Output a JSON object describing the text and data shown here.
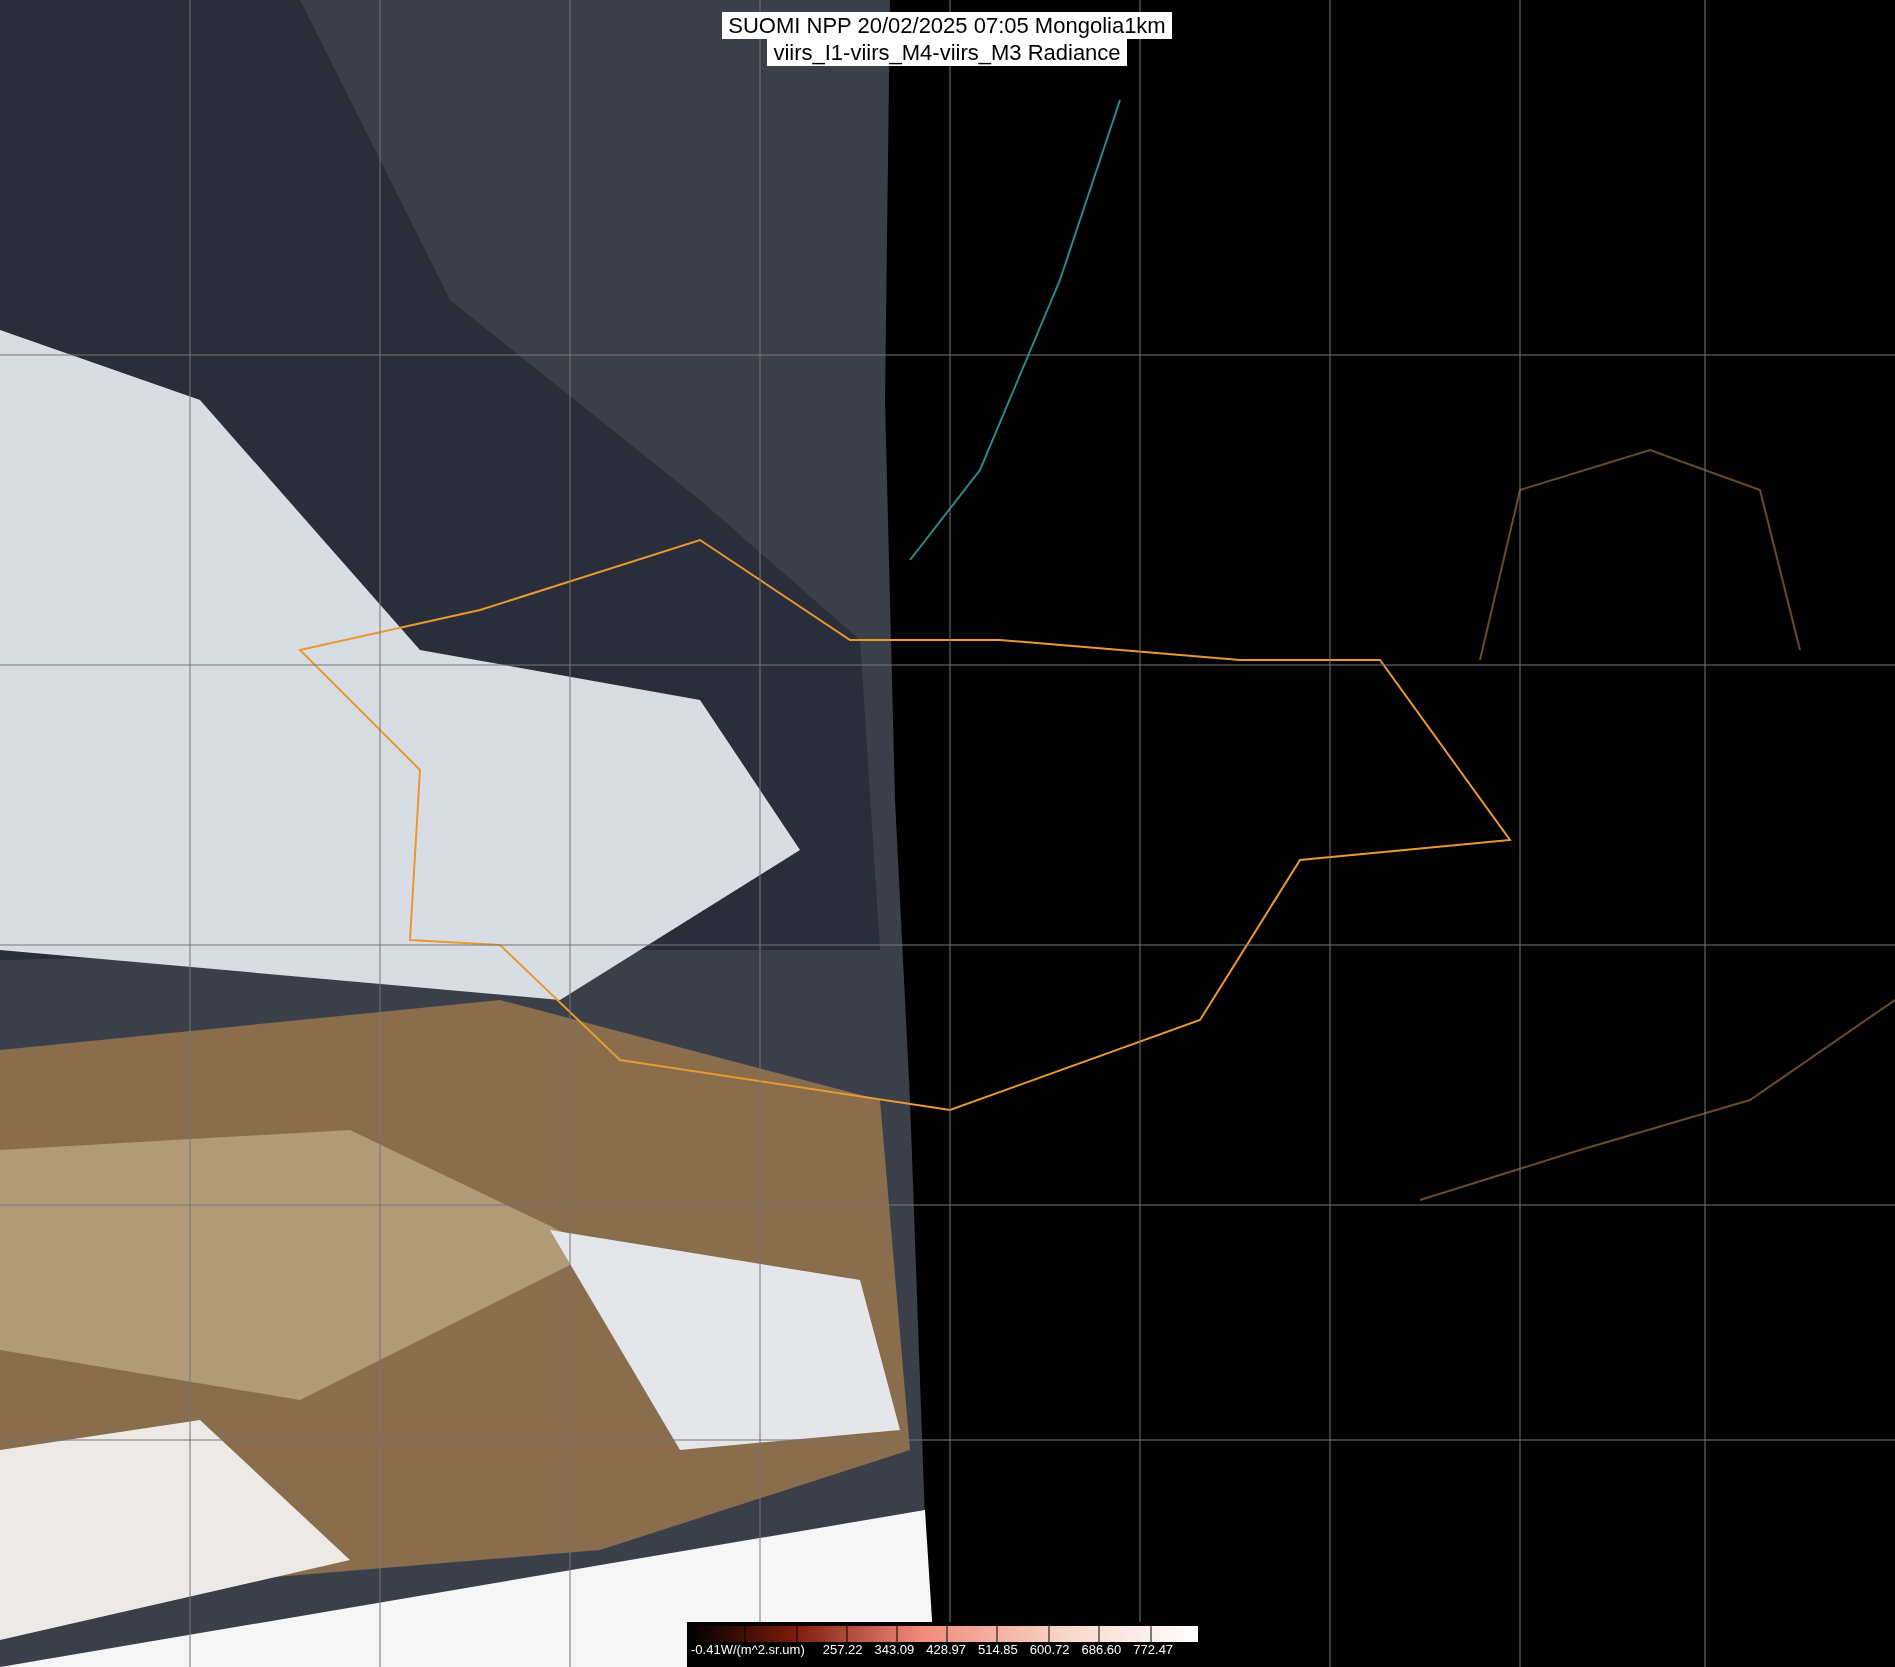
{
  "title": [
    "SUOMI NPP 20/02/2025 07:05 Mongolia1km",
    "viirs_I1-viirs_M4-viirs_M3 Radiance"
  ],
  "colorbar": {
    "labels": [
      "-0.41W/(m^2.sr.um)",
      "257.22",
      "343.09",
      "428.97",
      "514.85",
      "600.72",
      "686.60",
      "772.47"
    ]
  }
}
